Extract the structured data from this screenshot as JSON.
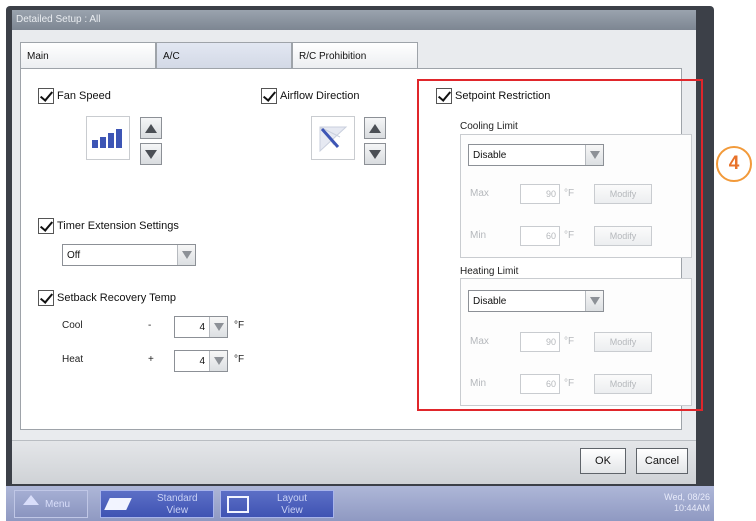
{
  "window": {
    "title": "Detailed Setup : All"
  },
  "tabs": [
    {
      "label": "Main"
    },
    {
      "label": "A/C"
    },
    {
      "label": "R/C Prohibition"
    }
  ],
  "fan_speed": {
    "label": "Fan Speed",
    "checked": true
  },
  "airflow": {
    "label": "Airflow Direction",
    "checked": true
  },
  "timer_extension": {
    "label": "Timer Extension Settings",
    "checked": true,
    "value": "Off"
  },
  "setback": {
    "label": "Setback Recovery Temp",
    "checked": true,
    "cool": {
      "label": "Cool",
      "sign": "-",
      "value": "4",
      "unit": "°F"
    },
    "heat": {
      "label": "Heat",
      "sign": "+",
      "value": "4",
      "unit": "°F"
    }
  },
  "setpoint_restriction": {
    "label": "Setpoint Restriction",
    "checked": true,
    "cooling": {
      "title": "Cooling Limit",
      "value": "Disable",
      "max": {
        "label": "Max",
        "value": "90",
        "unit": "°F",
        "button": "Modify"
      },
      "min": {
        "label": "Min",
        "value": "60",
        "unit": "°F",
        "button": "Modify"
      }
    },
    "heating": {
      "title": "Heating Limit",
      "value": "Disable",
      "max": {
        "label": "Max",
        "value": "90",
        "unit": "°F",
        "button": "Modify"
      },
      "min": {
        "label": "Min",
        "value": "60",
        "unit": "°F",
        "button": "Modify"
      }
    }
  },
  "callout": {
    "number": "4"
  },
  "footer": {
    "ok": "OK",
    "cancel": "Cancel"
  },
  "taskbar": {
    "menu": "Menu",
    "standard_view": [
      "Standard",
      "View"
    ],
    "layout_view": [
      "Layout",
      "View"
    ],
    "date": "Wed, 08/26",
    "time": "10:44AM"
  },
  "colors": {
    "highlight": "#e0262b",
    "callout": "#e8722a",
    "taskbar": "#8f99c2"
  }
}
